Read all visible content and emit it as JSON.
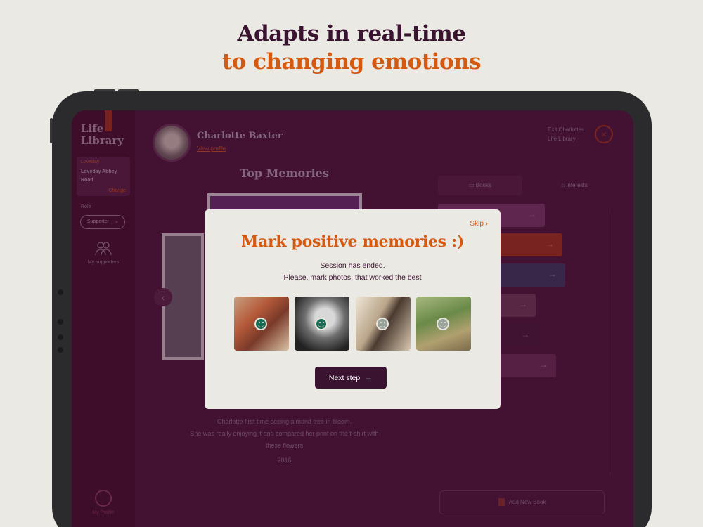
{
  "headline": {
    "line1": "Adapts in real-time",
    "line2": "to changing emotions"
  },
  "sidebar": {
    "logo": "Life Library",
    "address_label": "Loveday",
    "address": "Loveday Abbey Road",
    "address_change": "Change",
    "role_label": "Role",
    "role_value": "Supporter",
    "supporters_label": "My supporters",
    "profile_label": "My Profile"
  },
  "header": {
    "name": "Charlotte Baxter",
    "view_profile": "View profile",
    "edit_line1": "Exit Charlottes",
    "edit_line2": "Life Library",
    "close_icon": "×"
  },
  "memories": {
    "title": "Top Memories",
    "caption_line1": "Charlotte first time seeing almond tree in bloom.",
    "caption_line2": "She was really enjoying it and compared her print on the t-shirt with",
    "caption_line3": "these flowers",
    "year": "2016"
  },
  "right_panel": {
    "tab_books": "Books",
    "tab_interests": "Interests",
    "add_button": "Add New Book",
    "bar_colors": [
      "#7a3a68",
      "#a0341f",
      "#3f3a5e",
      "#6e3a55",
      "#4b1b3c",
      "#6a2f57"
    ]
  },
  "modal": {
    "skip": "Skip",
    "title": "Mark positive memories :)",
    "line1": "Session has ended.",
    "line2": "Please, mark photos, that worked the best",
    "next_button": "Next step",
    "photos": [
      {
        "marked": true,
        "icon": "smile-icon"
      },
      {
        "marked": true,
        "icon": "smile-icon"
      },
      {
        "marked": false,
        "icon": "smile-icon"
      },
      {
        "marked": false,
        "icon": "smile-icon"
      }
    ],
    "accent": "#d45a12",
    "button_color": "#3a1330",
    "marked_color": "#1a6b54"
  }
}
